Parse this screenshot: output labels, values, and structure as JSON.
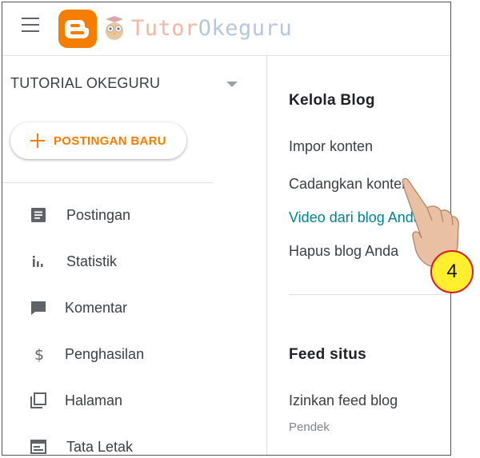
{
  "header": {
    "watermark_left": "Tutor",
    "watermark_right": "Okeguru"
  },
  "sidebar": {
    "blog_name": "TUTORIAL OKEGURU",
    "new_post_label": "POSTINGAN BARU",
    "items": [
      {
        "label": "Postingan",
        "icon": "posts-icon"
      },
      {
        "label": "Statistik",
        "icon": "stats-icon"
      },
      {
        "label": "Komentar",
        "icon": "comments-icon"
      },
      {
        "label": "Penghasilan",
        "icon": "dollar-icon"
      },
      {
        "label": "Halaman",
        "icon": "pages-icon"
      },
      {
        "label": "Tata Letak",
        "icon": "layout-icon"
      }
    ]
  },
  "main": {
    "manage_title": "Kelola Blog",
    "manage_links": [
      "Impor konten",
      "Cadangkan konten",
      "Video dari blog Anda",
      "Hapus blog Anda"
    ],
    "feed_title": "Feed situs",
    "feed_label": "Izinkan feed blog",
    "feed_value": "Pendek"
  },
  "annotation": {
    "step_number": "4"
  },
  "colors": {
    "accent": "#f57d00",
    "link_teal": "#00838f",
    "badge_fill": "#ffef2e",
    "badge_border": "#d81b1b"
  }
}
